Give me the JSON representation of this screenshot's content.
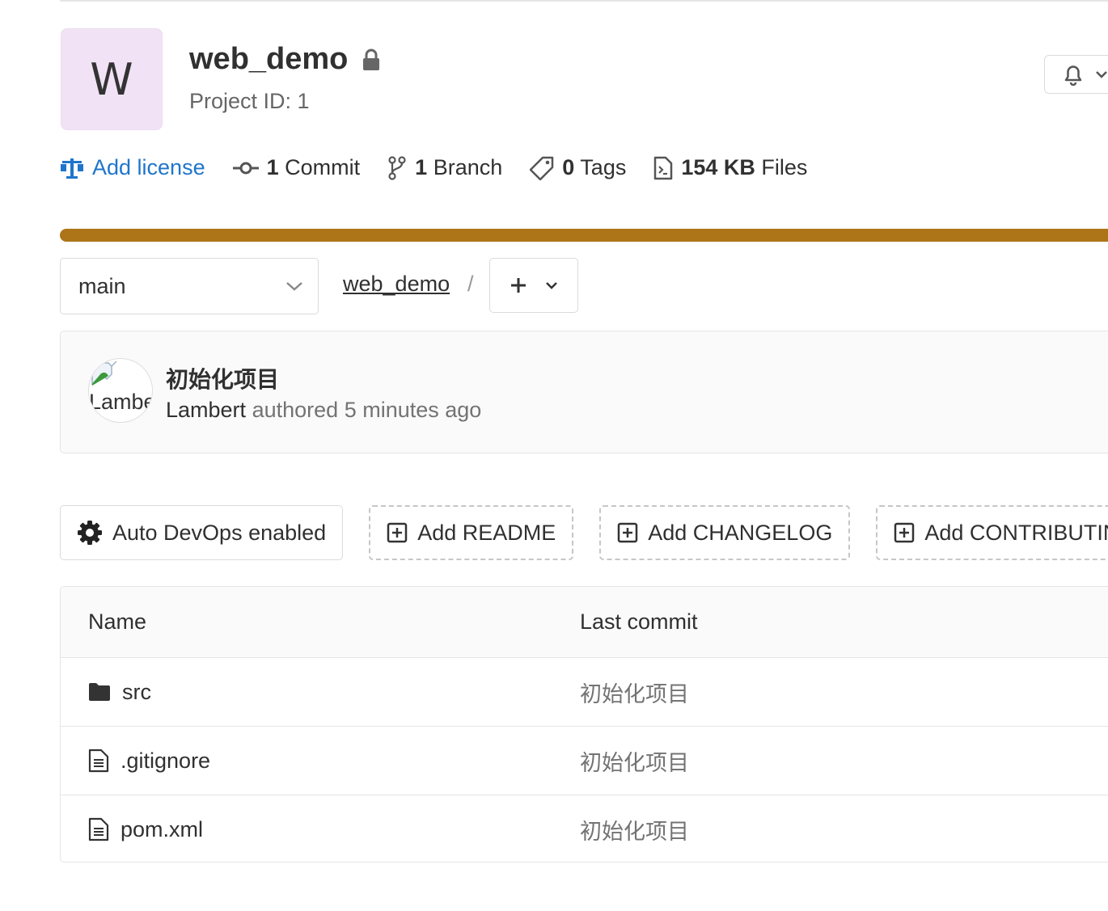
{
  "project": {
    "avatar_letter": "W",
    "name": "web_demo",
    "id_label": "Project ID: 1"
  },
  "stats": {
    "license": "Add license",
    "commits_count": "1",
    "commits_label": "Commit",
    "branches_count": "1",
    "branches_label": "Branch",
    "tags_count": "0",
    "tags_label": "Tags",
    "files_size": "154 KB",
    "files_label": "Files"
  },
  "language_bar": {
    "color": "#ad7418",
    "fraction": 1.0
  },
  "repo_nav": {
    "branch": "main",
    "breadcrumb": "web_demo",
    "separator": "/",
    "add_symbol": "+"
  },
  "last_commit": {
    "title": "初始化项目",
    "avatar_alt": "Lambert",
    "author": "Lambert",
    "action": "authored",
    "time": "5 minutes ago"
  },
  "actions": {
    "auto_devops": "Auto DevOps enabled",
    "add_readme": "Add README",
    "add_changelog": "Add CHANGELOG",
    "add_contributing": "Add CONTRIBUTING"
  },
  "files": {
    "headers": {
      "name": "Name",
      "last_commit": "Last commit"
    },
    "rows": [
      {
        "name": "src",
        "type": "folder-icon",
        "commit": "初始化项目"
      },
      {
        "name": ".gitignore",
        "type": "file-icon",
        "commit": "初始化项目"
      },
      {
        "name": "pom.xml",
        "type": "file-icon",
        "commit": "初始化项目"
      }
    ]
  }
}
